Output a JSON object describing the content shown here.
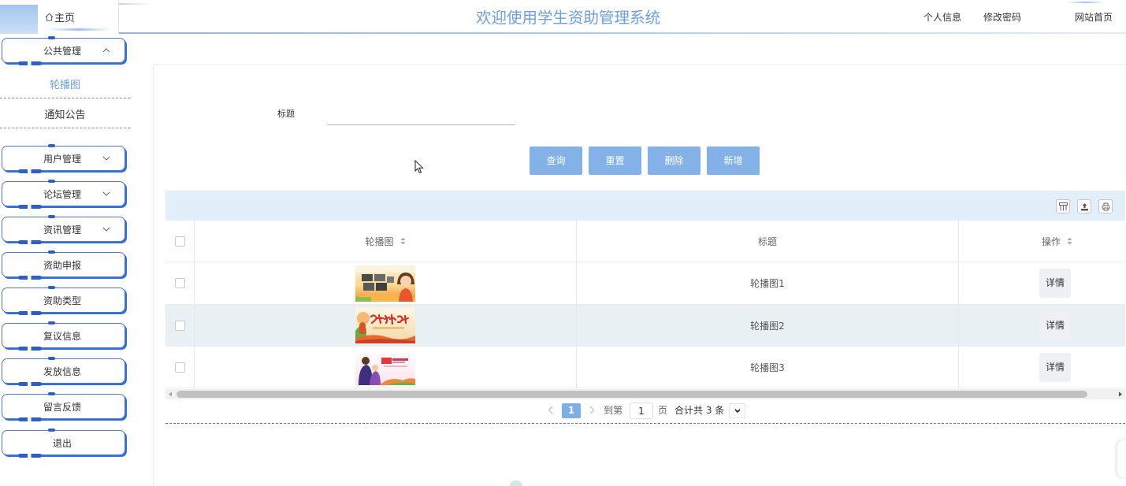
{
  "header": {
    "home_icon": "home-icon",
    "home_label": "主页",
    "title": "欢迎使用学生资助管理系统",
    "links": [
      {
        "label": "个人信息"
      },
      {
        "label": "修改密码"
      },
      {
        "label": "网站首页"
      }
    ]
  },
  "sidebar": {
    "menus": [
      {
        "label": "公共管理",
        "expanded": true,
        "chevron_icon": "chevron-up-icon",
        "children": [
          {
            "label": "轮播图",
            "active": true
          },
          {
            "label": "通知公告",
            "active": false
          }
        ]
      },
      {
        "label": "用户管理",
        "expanded": false,
        "chevron_icon": "chevron-down-icon"
      },
      {
        "label": "论坛管理",
        "expanded": false,
        "chevron_icon": "chevron-down-icon"
      },
      {
        "label": "资讯管理",
        "expanded": false,
        "chevron_icon": "chevron-down-icon"
      },
      {
        "label": "资助申报"
      },
      {
        "label": "资助类型"
      },
      {
        "label": "复议信息"
      },
      {
        "label": "发放信息"
      },
      {
        "label": "留言反馈"
      },
      {
        "label": "退出"
      }
    ]
  },
  "search": {
    "label": "标题",
    "value": "",
    "placeholder": ""
  },
  "actions": {
    "query": "查询",
    "reset": "重置",
    "delete": "删除",
    "add": "新增"
  },
  "table": {
    "toolbar_icons": [
      "columns-icon",
      "export-icon",
      "print-icon"
    ],
    "select_all_checked": false,
    "columns": [
      {
        "label": "轮播图",
        "sortable": true
      },
      {
        "label": "标题",
        "sortable": false
      },
      {
        "label": "操作",
        "sortable": true
      }
    ],
    "rows": [
      {
        "checked": false,
        "highlighted": false,
        "title": "轮播图1",
        "action": "详情"
      },
      {
        "checked": false,
        "highlighted": true,
        "title": "轮播图2",
        "action": "详情"
      },
      {
        "checked": false,
        "highlighted": false,
        "title": "轮播图3",
        "action": "详情"
      }
    ]
  },
  "pagination": {
    "prev_icon": "chevron-left-icon",
    "current_page": "1",
    "next_icon": "chevron-right-icon",
    "goto_prefix": "到第",
    "goto_value": "1",
    "goto_suffix": "页",
    "total_text": "合计共 3 条",
    "page_size_icon": "chevron-down-icon"
  },
  "colors": {
    "title": "#6e9fdb",
    "active_menu": "#6e9fdb",
    "button_bg": "#84b1e7",
    "toolbar_bg": "#e2eefa",
    "highlight_row_bg": "#e9f0f4",
    "pagination_active": "#7eaee6",
    "menu_border": "#5877b8",
    "menu_shadow": "#2d6fe6"
  }
}
